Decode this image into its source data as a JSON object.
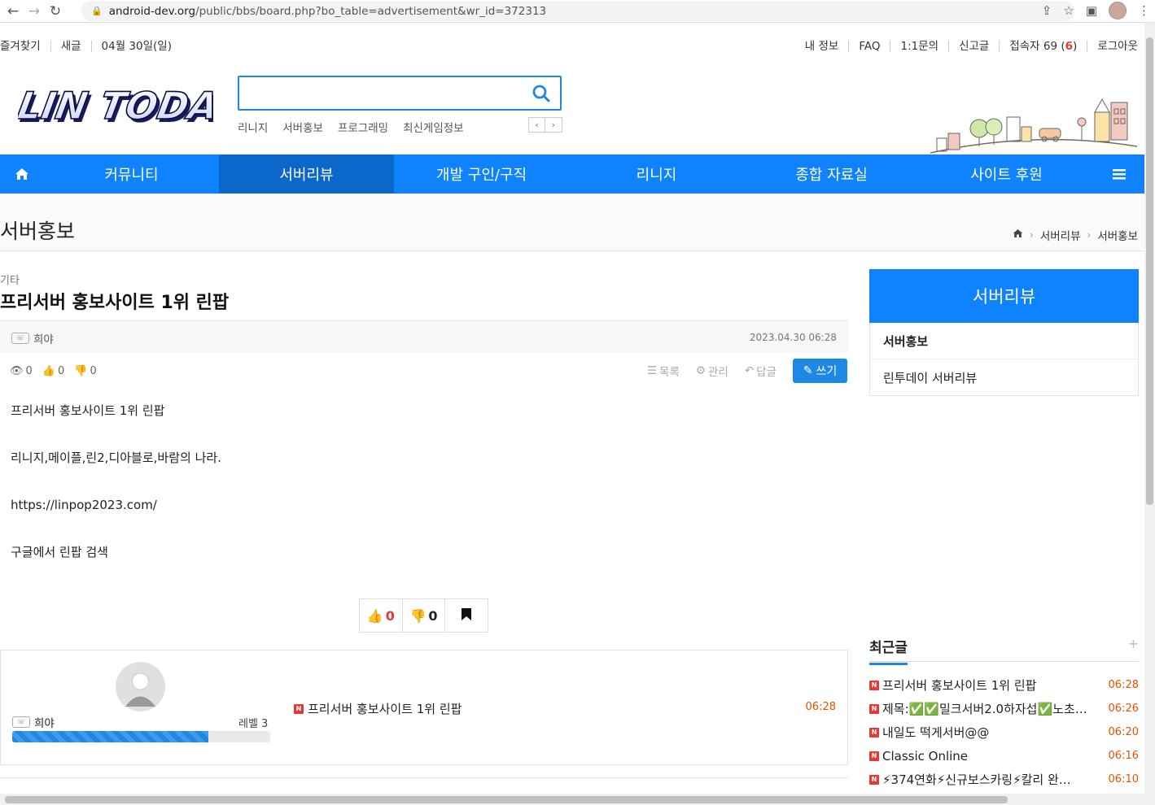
{
  "browser": {
    "url_domain": "android-dev.org",
    "url_path": "/public/bbs/board.php?bo_table=advertisement&wr_id=372313"
  },
  "topbar": {
    "left": [
      "즐겨찾기",
      "새글",
      "04월 30일(일)"
    ],
    "right": [
      "내 정보",
      "FAQ",
      "1:1문의",
      "신고글"
    ],
    "visitors_label": "접속자 69 (",
    "visitors_now": "6",
    "visitors_close": ")",
    "logout": "로그아웃"
  },
  "logo_text": "LIN TODAY",
  "search": {
    "placeholder": ""
  },
  "keywords": [
    "리니지",
    "서버홍보",
    "프로그래밍",
    "최신게임정보"
  ],
  "gnb": [
    "커뮤니티",
    "서버리뷰",
    "개발 구인/구직",
    "리니지",
    "종합 자료실",
    "사이트 후원"
  ],
  "page": {
    "title": "서버홍보",
    "breadcrumb": [
      "서버리뷰",
      "서버홍보"
    ]
  },
  "post": {
    "category": "기타",
    "subject": "프리서버 홍보사이트 1위 린팝",
    "writer": "희야",
    "datetime": "2023.04.30 06:28",
    "views": "0",
    "likes": "0",
    "dislikes": "0",
    "actions": {
      "list": "목록",
      "manage": "관리",
      "reply": "답글",
      "write": "쓰기"
    },
    "body": [
      "프리서버 홍보사이트 1위 린팝",
      "리니지,메이플,린2,디아블로,바람의 나라.",
      "https://linpop2023.com/",
      "구글에서 린팝 검색"
    ],
    "vote_good": "0",
    "vote_bad": "0"
  },
  "profile": {
    "name": "희야",
    "level": "레벨 3",
    "level_progress": 0.76,
    "latest_post": "프리서버 홍보사이트 1위 린팝",
    "latest_time": "06:28"
  },
  "sidebar": {
    "title": "서버리뷰",
    "items": [
      "서버홍보",
      "린투데이 서버리뷰"
    ]
  },
  "recent": {
    "title": "최근글",
    "plus": "+",
    "items": [
      {
        "text": "프리서버 홍보사이트 1위 린팝",
        "time": "06:28"
      },
      {
        "text": "제목:✅✅밀크서버2.0하자섭✅노초…",
        "time": "06:26"
      },
      {
        "text": "내일도 떡게서버@@",
        "time": "06:20"
      },
      {
        "text": "Classic Online",
        "time": "06:16"
      },
      {
        "text": "⚡374연화⚡신규보스카링⚡칼리 완…",
        "time": "06:10"
      }
    ]
  },
  "colors": {
    "primary": "#0f83fd",
    "active": "#0b67c9",
    "accent_red": "#e53935",
    "time": "#e65100"
  }
}
